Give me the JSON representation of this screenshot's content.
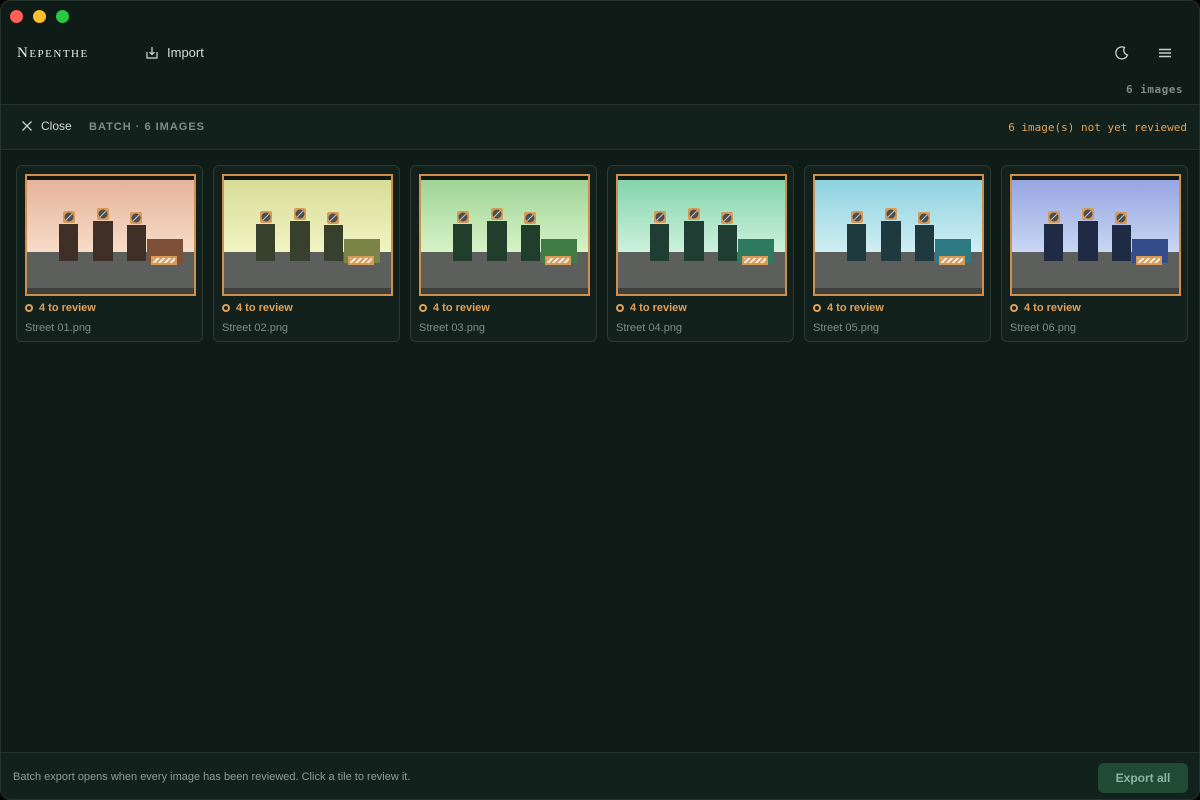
{
  "app": {
    "brand": "Nepenthe",
    "import_label": "Import",
    "image_count": "6 images"
  },
  "batch": {
    "close_label": "Close",
    "label": "BATCH · 6 IMAGES",
    "not_reviewed": "6 image(s) not yet reviewed"
  },
  "tiles": [
    {
      "status": "4 to review",
      "filename": "Street 01.png",
      "sky_top": "#e6b39b",
      "sky_bottom": "#f7dcc8",
      "figure": "#3e2f27",
      "box": "#7e5038"
    },
    {
      "status": "4 to review",
      "filename": "Street 02.png",
      "sky_top": "#d8dc98",
      "sky_bottom": "#f1f4c2",
      "figure": "#37402c",
      "box": "#7a8447"
    },
    {
      "status": "4 to review",
      "filename": "Street 03.png",
      "sky_top": "#9fd497",
      "sky_bottom": "#d6f3c6",
      "figure": "#213e2c",
      "box": "#3f7d45"
    },
    {
      "status": "4 to review",
      "filename": "Street 04.png",
      "sky_top": "#84d4ad",
      "sky_bottom": "#cdf1dc",
      "figure": "#1f3d33",
      "box": "#2e7a60"
    },
    {
      "status": "4 to review",
      "filename": "Street 05.png",
      "sky_top": "#8ed2e0",
      "sky_bottom": "#d0eef3",
      "figure": "#1f3a3e",
      "box": "#2e7a83"
    },
    {
      "status": "4 to review",
      "filename": "Street 06.png",
      "sky_top": "#96a6e0",
      "sky_bottom": "#c9d6f4",
      "figure": "#1f2a44",
      "box": "#344d8a"
    }
  ],
  "footer": {
    "hint": "Batch export opens when every image has been reviewed. Click a tile to review it.",
    "export_label": "Export all"
  },
  "colors": {
    "accent": "#e0a05a",
    "background": "#0f1b17",
    "export_button": "#1f4a34"
  },
  "icons": {
    "import": "import-icon",
    "theme": "moon-icon",
    "menu": "hamburger-menu-icon",
    "close": "close-x-icon",
    "status": "ring-icon"
  }
}
